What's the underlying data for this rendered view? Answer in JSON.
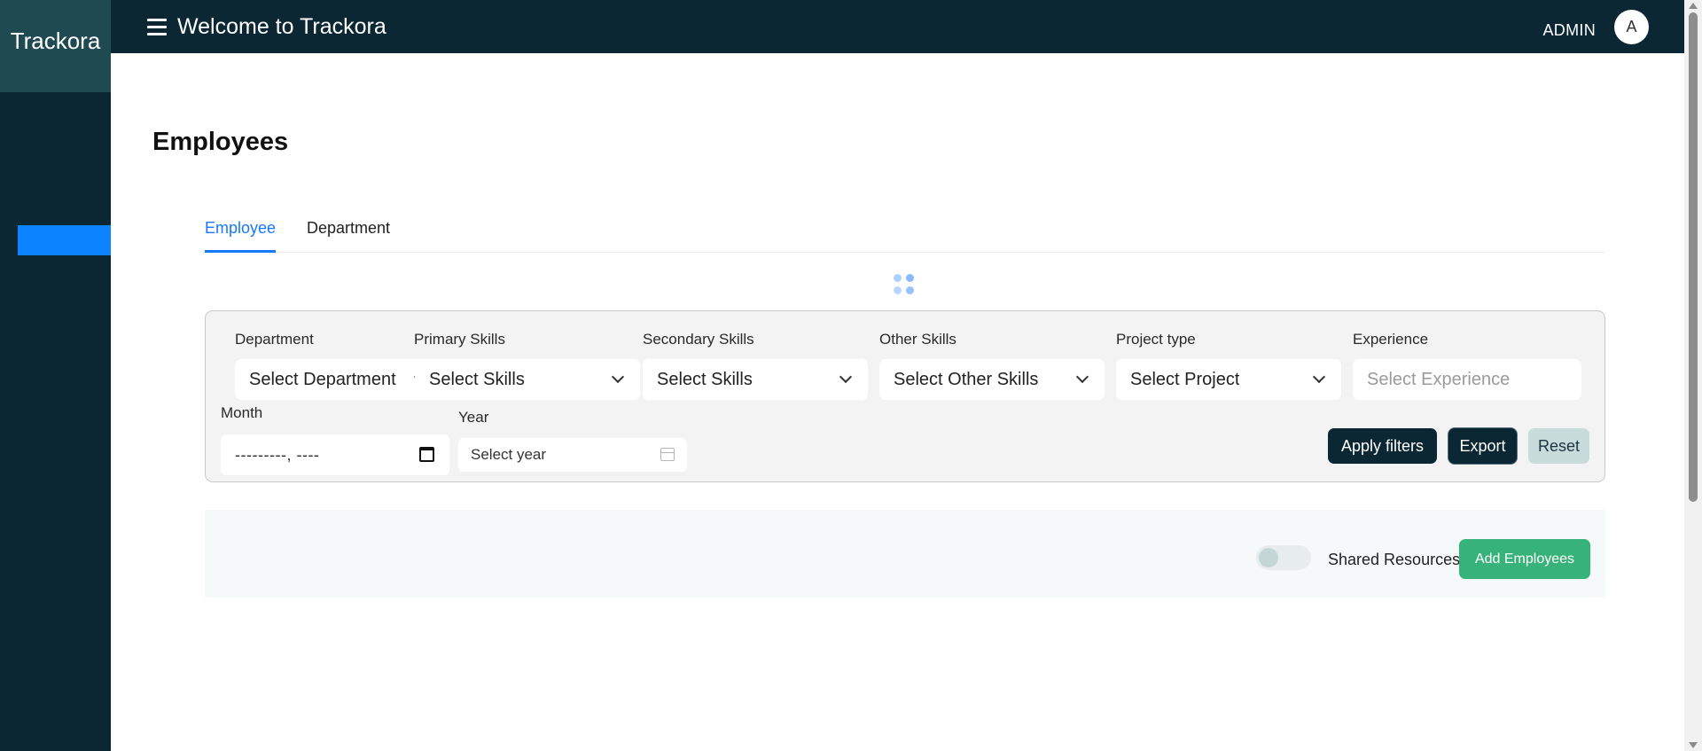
{
  "app": {
    "brand": "Trackora"
  },
  "header": {
    "welcome": "Welcome to Trackora",
    "user_role": "ADMIN",
    "avatar_initial": "A"
  },
  "page": {
    "title": "Employees"
  },
  "tabs": [
    {
      "label": "Employee",
      "active": true
    },
    {
      "label": "Department",
      "active": false
    }
  ],
  "filters": {
    "department": {
      "label": "Department",
      "placeholder": "Select Department"
    },
    "primary_skills": {
      "label": "Primary Skills",
      "placeholder": "Select Skills"
    },
    "secondary_skills": {
      "label": "Secondary Skills",
      "placeholder": "Select Skills"
    },
    "other_skills": {
      "label": "Other Skills",
      "placeholder": "Select Other Skills"
    },
    "project_type": {
      "label": "Project type",
      "placeholder": "Select Project"
    },
    "experience": {
      "label": "Experience",
      "placeholder": "Select Experience"
    },
    "month": {
      "label": "Month",
      "value": "---------, ----"
    },
    "year": {
      "label": "Year",
      "placeholder": "Select year"
    },
    "apply_label": "Apply filters",
    "export_label": "Export",
    "reset_label": "Reset"
  },
  "actions": {
    "shared_resources_label": "Shared Resources",
    "shared_resources_on": false,
    "add_label": "Add Employees"
  },
  "colors": {
    "navy": "#0b2733",
    "brand_bg": "#1f4a52",
    "sidebar_active": "#0d84ff",
    "tab_active": "#1677ff",
    "add_button": "#37b278",
    "reset_button": "#c7dcdb"
  }
}
